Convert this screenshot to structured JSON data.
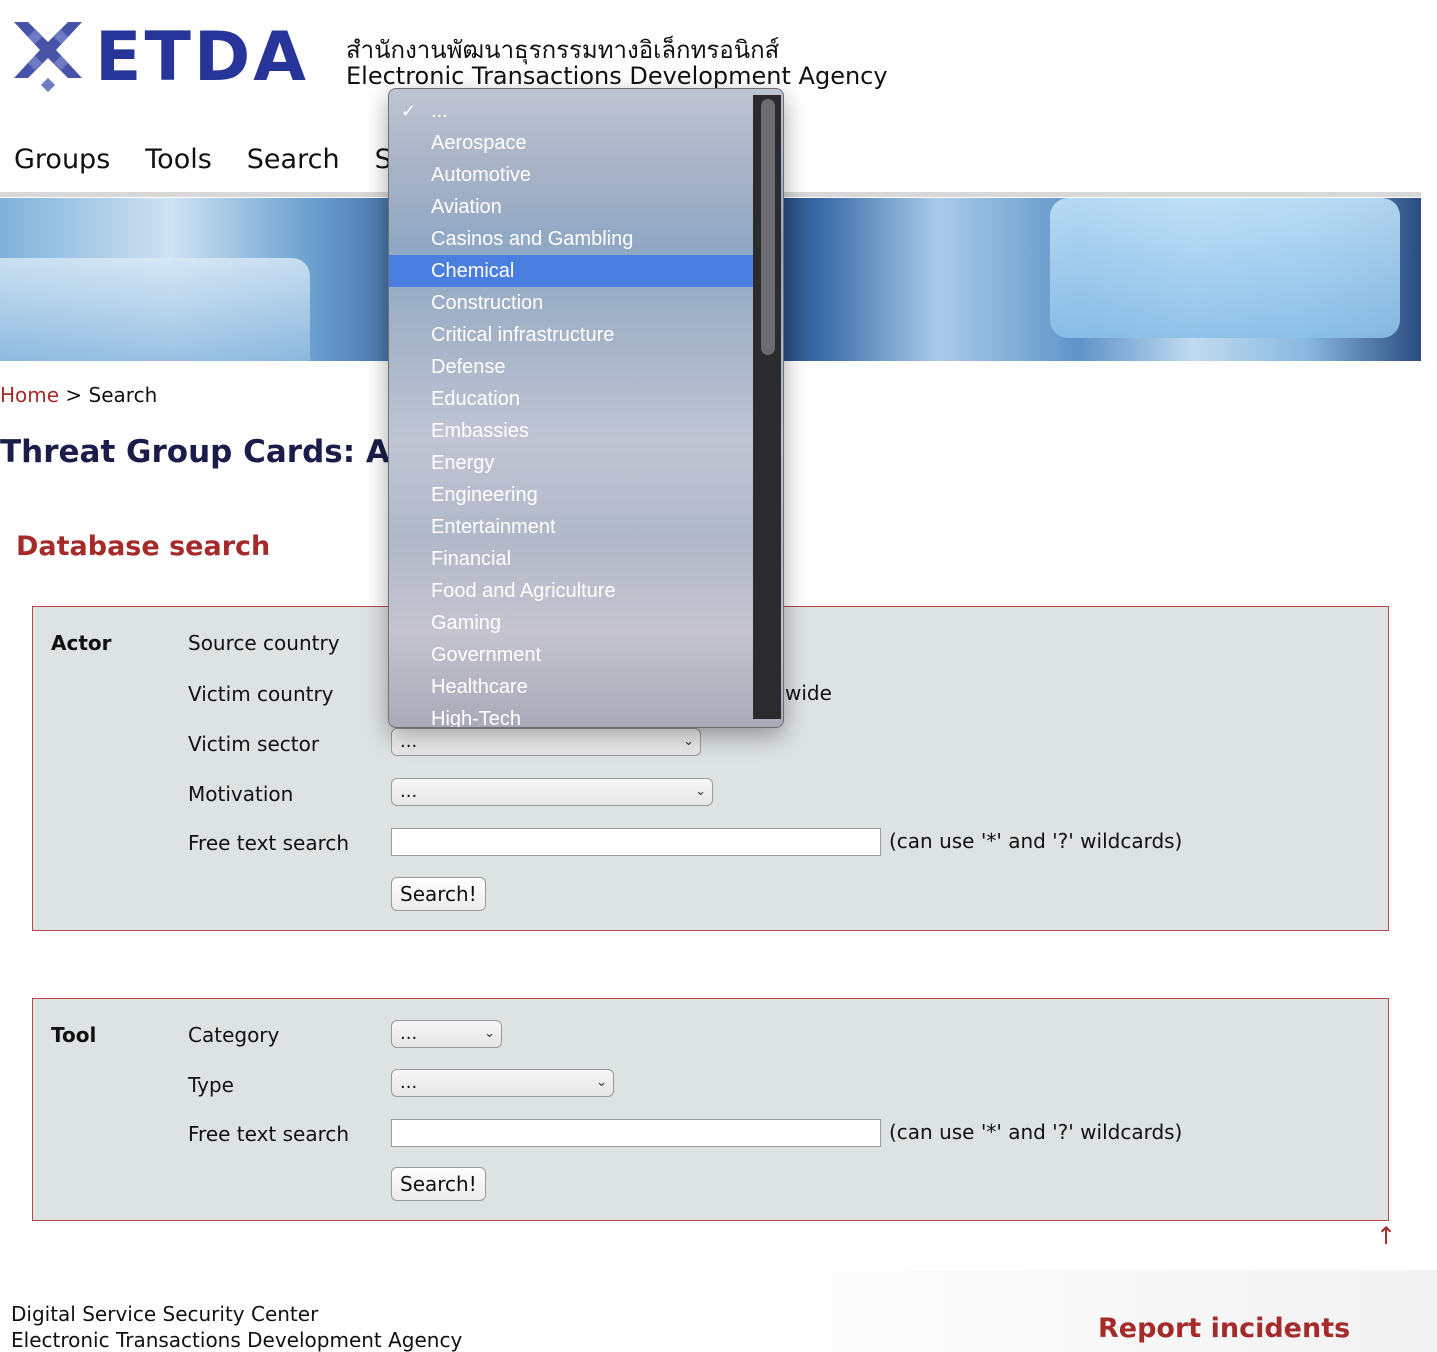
{
  "header": {
    "logo_text": "ETDA",
    "org_thai": "สำนักงานพัฒนาธุรกรรมทางอิเล็กทรอนิกส์",
    "org_english": "Electronic Transactions Development Agency"
  },
  "nav": [
    "Groups",
    "Tools",
    "Search",
    "Stat"
  ],
  "breadcrumb": {
    "home": "Home",
    "separator": ">",
    "current": "Search"
  },
  "page_title": "Threat Group Cards: A Thr",
  "section_title": "Database search",
  "actor_panel": {
    "heading": "Actor",
    "fields": {
      "source_country": "Source country",
      "victim_country": "Victim country",
      "victim_country_tail": "wide",
      "victim_sector": "Victim sector",
      "motivation": "Motivation",
      "free_text": "Free text search"
    },
    "victim_sector_value": "...",
    "motivation_value": "...",
    "wildcard_hint": "(can use '*' and '?' wildcards)",
    "search_button": "Search!"
  },
  "tool_panel": {
    "heading": "Tool",
    "fields": {
      "category": "Category",
      "type": "Type",
      "free_text": "Free text search"
    },
    "category_value": "...",
    "type_value": "...",
    "wildcard_hint": "(can use '*' and '?' wildcards)",
    "search_button": "Search!"
  },
  "back_to_top": "↑",
  "footer": {
    "line1": "Digital Service Security Center",
    "line2": "Electronic Transactions Development Agency",
    "report": "Report incidents"
  },
  "dropdown": {
    "checkmark": "✓",
    "highlighted": "Chemical",
    "options": [
      "...",
      "Aerospace",
      "Automotive",
      "Aviation",
      "Casinos and Gambling",
      "Chemical",
      "Construction",
      "Critical infrastructure",
      "Defense",
      "Education",
      "Embassies",
      "Energy",
      "Engineering",
      "Entertainment",
      "Financial",
      "Food and Agriculture",
      "Gaming",
      "Government",
      "Healthcare",
      "High-Tech"
    ]
  },
  "colors": {
    "brand": "#27349a",
    "accent": "#a52a2a",
    "highlight": "#4a7ee0"
  }
}
